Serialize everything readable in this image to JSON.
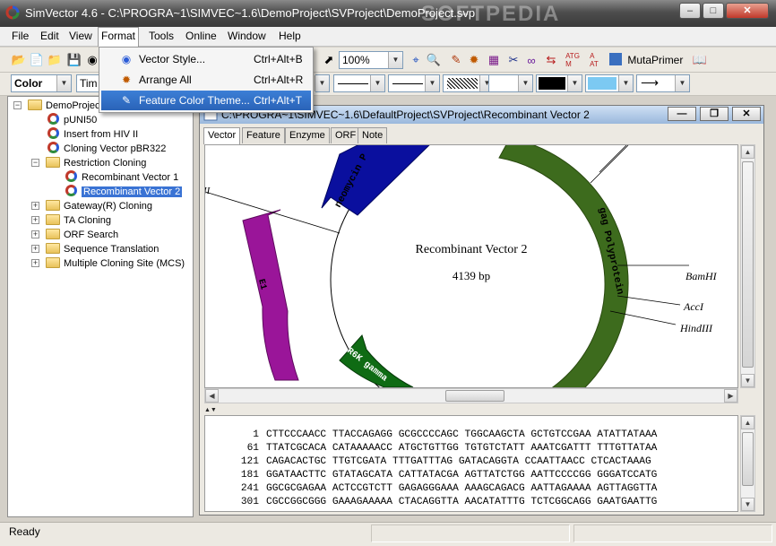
{
  "window": {
    "title": "SimVector 4.6 - C:\\PROGRA~1\\SIMVEC~1.6\\DemoProject\\SVProject\\DemoProject.svp",
    "watermark": "SOFTPEDIA"
  },
  "menubar": {
    "items": [
      "File",
      "Edit",
      "View",
      "Format",
      "Tools",
      "Online",
      "Window",
      "Help"
    ]
  },
  "format_menu": {
    "items": [
      {
        "label": "Vector Style...",
        "shortcut": "Ctrl+Alt+B",
        "icon": "vector-style-icon"
      },
      {
        "label": "Arrange All",
        "shortcut": "Ctrl+Alt+R",
        "icon": "arrange-icon"
      },
      {
        "label": "Feature Color Theme...",
        "shortcut": "Ctrl+Alt+T",
        "icon": "color-theme-icon"
      }
    ]
  },
  "toolbar1": {
    "zoom": "100%",
    "mutaprimer": "MutaPrimer"
  },
  "toolbar2": {
    "color_combo": "Color",
    "font_combo": "Tim"
  },
  "tree": {
    "root": "DemoProject",
    "items": [
      {
        "label": "pUNI50",
        "type": "vector"
      },
      {
        "label": "Insert from HIV II",
        "type": "vector"
      },
      {
        "label": "Cloning Vector pBR322",
        "type": "vector"
      },
      {
        "label": "Restriction Cloning",
        "type": "folder"
      },
      {
        "label": "Recombinant Vector 1",
        "type": "vector"
      },
      {
        "label": "Recombinant Vector 2",
        "type": "vector",
        "selected": true
      },
      {
        "label": "Gateway(R) Cloning",
        "type": "folder"
      },
      {
        "label": "TA Cloning",
        "type": "folder"
      },
      {
        "label": "ORF Search",
        "type": "folder"
      },
      {
        "label": "Sequence Translation",
        "type": "folder"
      },
      {
        "label": "Multiple Cloning Site (MCS)",
        "type": "folder"
      }
    ]
  },
  "doc": {
    "title": "C:\\PROGRA~1\\SIMVEC~1.6\\DefaultProject\\SVProject\\Recombinant Vector 2",
    "tabs": [
      "Vector",
      "Feature",
      "Enzyme",
      "ORF",
      "Note"
    ],
    "active_tab": "Vector"
  },
  "map": {
    "name": "Recombinant Vector 2",
    "size": "4139 bp",
    "features": [
      {
        "label": "neomycin P",
        "color": "#0a0f9e"
      },
      {
        "label": "gag Polyprotein",
        "color": "#3d6b1d"
      },
      {
        "label": "R6K gamma",
        "color": "#0f6b14"
      },
      {
        "label": "E1",
        "color": "#9a1599"
      }
    ],
    "sites": [
      "BamHI",
      "AccI",
      "HindIII"
    ],
    "site_left": "II"
  },
  "sequence": {
    "lines": [
      {
        "num": "1",
        "seq": "CTTCCCAACC TTACCAGAGG GCGCCCCAGC TGGCAAGCTA GCTGTCCGAA ATATTATAAA"
      },
      {
        "num": "61",
        "seq": "TTATCGCACA CATAAAAACC ATGCTGTTGG TGTGTCTATT AAATCGATTT TTTGTTATAA"
      },
      {
        "num": "121",
        "seq": "CAGACACTGC TTGTCGATA TTTGATTTAG GATACAGGTA CCAATTAACC CTCACTAAAG"
      },
      {
        "num": "181",
        "seq": "GGATAACTTC GTATAGCATA CATTATACGA AGTTATCTGG AATTCCCCGG GGGATCCATG"
      },
      {
        "num": "241",
        "seq": "GGCGCGAGAA ACTCCGTCTT GAGAGGGAAA AAAGCAGACG AATTAGAAAA AGTTAGGTTA"
      },
      {
        "num": "301",
        "seq": "CGCCGGCGGG GAAAGAAAAA CTACAGGTTA AACATATTTG TCTCGGCAGG GAATGAATTG"
      }
    ]
  },
  "status": {
    "text": "Ready"
  }
}
